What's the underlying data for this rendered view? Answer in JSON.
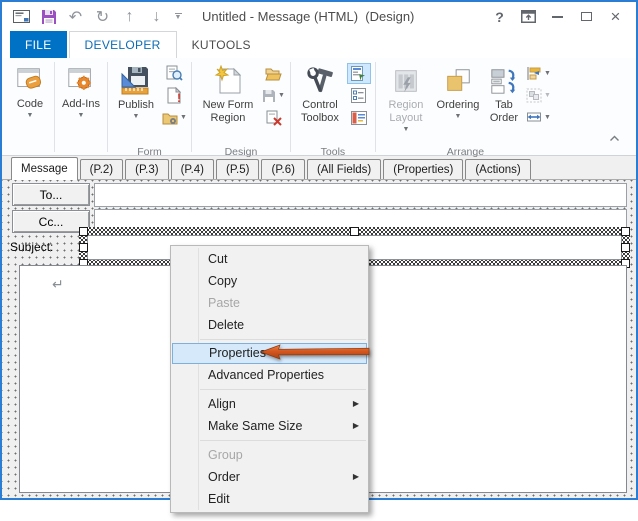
{
  "window": {
    "title": "Untitled - Message (HTML)  (Design)",
    "qat_icons": [
      "message-icon",
      "save-icon",
      "undo-icon",
      "redo-icon",
      "move-up-icon",
      "move-down-icon",
      "qat-customize-icon"
    ],
    "caption_icons": [
      "help-icon",
      "ribbon-display-options-icon",
      "minimize-icon",
      "maximize-icon",
      "close-icon"
    ],
    "undo_glyph": "↶",
    "redo_glyph": "↻",
    "up_glyph": "↑",
    "down_glyph": "↓",
    "help_glyph": "?",
    "close_glyph": "×"
  },
  "colors": {
    "accent_blue": "#0072c6",
    "window_border": "#2b7cd3",
    "menu_highlight_bg": "#d5e9fa",
    "menu_highlight_border": "#7fb0dc",
    "arrow_orange": "#d4561e",
    "toggled_small_button_bg": "#cde8ff"
  },
  "ribbon_tabs": [
    {
      "label": "FILE",
      "active": false
    },
    {
      "label": "DEVELOPER",
      "active": true
    },
    {
      "label": "KUTOOLS",
      "active": false
    }
  ],
  "ribbon": {
    "collapsed_buttons": [
      {
        "label": "Code",
        "icon": "code-icon"
      },
      {
        "label": "Add-Ins",
        "icon": "addins-icon"
      }
    ],
    "groups": {
      "form": {
        "label": "Form",
        "publish": "Publish",
        "small_icons": [
          "view-code-icon",
          "run-this-form-icon",
          "form-attributes-icon"
        ]
      },
      "design": {
        "label": "Design",
        "new_form_region": "New Form Region",
        "small_icons": [
          "open-region-icon",
          "save-region-icon",
          "close-region-icon"
        ]
      },
      "tools": {
        "label": "Tools",
        "control_toolbox": "Control Toolbox",
        "small_icons": [
          "field-chooser-icon",
          "property-sheet-icon",
          "advanced-properties-icon"
        ]
      },
      "arrange": {
        "label": "Arrange",
        "region_layout": "Region Layout",
        "ordering": "Ordering",
        "tab_order": "Tab Order",
        "small_icons": [
          "align-icon",
          "group-icon",
          "size-icon"
        ]
      }
    }
  },
  "form_tabs": [
    {
      "label": "Message",
      "active": true
    },
    {
      "label": "(P.2)"
    },
    {
      "label": "(P.3)"
    },
    {
      "label": "(P.4)"
    },
    {
      "label": "(P.5)"
    },
    {
      "label": "(P.6)"
    },
    {
      "label": "(All Fields)"
    },
    {
      "label": "(Properties)"
    },
    {
      "label": "(Actions)"
    }
  ],
  "form": {
    "to_button": "To...",
    "cc_button": "Cc...",
    "subject_label": "Subject:",
    "body_paragraph_mark": "↵"
  },
  "context_menu": {
    "items": [
      {
        "label": "Cut"
      },
      {
        "label": "Copy"
      },
      {
        "label": "Paste",
        "disabled": true
      },
      {
        "label": "Delete"
      },
      {
        "label": "Properties",
        "highlighted": true
      },
      {
        "label": "Advanced Properties"
      },
      {
        "label": "Align",
        "submenu": true
      },
      {
        "label": "Make Same Size",
        "submenu": true
      },
      {
        "label": "Group",
        "disabled": true
      },
      {
        "label": "Order",
        "submenu": true
      },
      {
        "label": "Edit"
      }
    ]
  }
}
